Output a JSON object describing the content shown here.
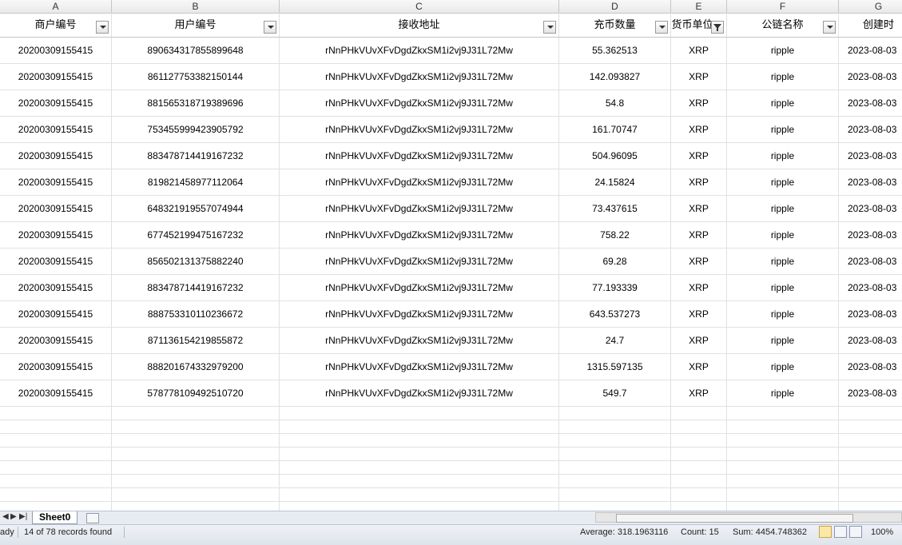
{
  "columns": [
    "A",
    "B",
    "C",
    "D",
    "E",
    "F",
    "G"
  ],
  "headers": [
    "商户编号",
    "用户编号",
    "接收地址",
    "充币数量",
    "货币单位",
    "公链名称",
    "创建时"
  ],
  "rows": [
    [
      "20200309155415",
      "890634317855899648",
      "rNnPHkVUvXFvDgdZkxSM1i2vj9J31L72Mw",
      "55.362513",
      "XRP",
      "ripple",
      "2023-08-03"
    ],
    [
      "20200309155415",
      "861127753382150144",
      "rNnPHkVUvXFvDgdZkxSM1i2vj9J31L72Mw",
      "142.093827",
      "XRP",
      "ripple",
      "2023-08-03"
    ],
    [
      "20200309155415",
      "881565318719389696",
      "rNnPHkVUvXFvDgdZkxSM1i2vj9J31L72Mw",
      "54.8",
      "XRP",
      "ripple",
      "2023-08-03"
    ],
    [
      "20200309155415",
      "753455999423905792",
      "rNnPHkVUvXFvDgdZkxSM1i2vj9J31L72Mw",
      "161.70747",
      "XRP",
      "ripple",
      "2023-08-03"
    ],
    [
      "20200309155415",
      "883478714419167232",
      "rNnPHkVUvXFvDgdZkxSM1i2vj9J31L72Mw",
      "504.96095",
      "XRP",
      "ripple",
      "2023-08-03"
    ],
    [
      "20200309155415",
      "819821458977112064",
      "rNnPHkVUvXFvDgdZkxSM1i2vj9J31L72Mw",
      "24.15824",
      "XRP",
      "ripple",
      "2023-08-03"
    ],
    [
      "20200309155415",
      "648321919557074944",
      "rNnPHkVUvXFvDgdZkxSM1i2vj9J31L72Mw",
      "73.437615",
      "XRP",
      "ripple",
      "2023-08-03"
    ],
    [
      "20200309155415",
      "677452199475167232",
      "rNnPHkVUvXFvDgdZkxSM1i2vj9J31L72Mw",
      "758.22",
      "XRP",
      "ripple",
      "2023-08-03"
    ],
    [
      "20200309155415",
      "856502131375882240",
      "rNnPHkVUvXFvDgdZkxSM1i2vj9J31L72Mw",
      "69.28",
      "XRP",
      "ripple",
      "2023-08-03"
    ],
    [
      "20200309155415",
      "883478714419167232",
      "rNnPHkVUvXFvDgdZkxSM1i2vj9J31L72Mw",
      "77.193339",
      "XRP",
      "ripple",
      "2023-08-03"
    ],
    [
      "20200309155415",
      "888753310110236672",
      "rNnPHkVUvXFvDgdZkxSM1i2vj9J31L72Mw",
      "643.537273",
      "XRP",
      "ripple",
      "2023-08-03"
    ],
    [
      "20200309155415",
      "871136154219855872",
      "rNnPHkVUvXFvDgdZkxSM1i2vj9J31L72Mw",
      "24.7",
      "XRP",
      "ripple",
      "2023-08-03"
    ],
    [
      "20200309155415",
      "888201674332979200",
      "rNnPHkVUvXFvDgdZkxSM1i2vj9J31L72Mw",
      "1315.597135",
      "XRP",
      "ripple",
      "2023-08-03"
    ],
    [
      "20200309155415",
      "578778109492510720",
      "rNnPHkVUvXFvDgdZkxSM1i2vj9J31L72Mw",
      "549.7",
      "XRP",
      "ripple",
      "2023-08-03"
    ]
  ],
  "filtered_column_index": 4,
  "sheet_tab": "Sheet0",
  "status": {
    "ready": "ady",
    "records": "14 of 78 records found",
    "average": "Average: 318.1963116",
    "count": "Count: 15",
    "sum": "Sum: 4454.748362",
    "zoom": "100%"
  },
  "icons": {
    "filter": "filter-dropdown-icon",
    "filter_active": "filter-active-icon",
    "new_sheet": "insert-sheet-icon",
    "normal_view": "normal-view-icon",
    "page_layout": "page-layout-icon",
    "page_break": "page-break-preview-icon"
  }
}
